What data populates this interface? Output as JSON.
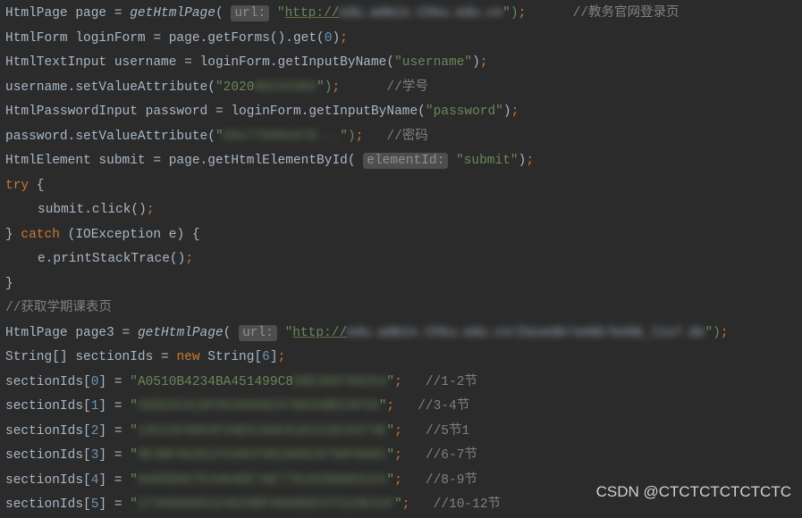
{
  "lines": {
    "l1": {
      "p1": "HtmlPage page = ",
      "method": "getHtmlPage",
      "hint": "url:",
      "q": "\"",
      "url": "http://",
      "blur": "edu.admin.thku.edu.cn",
      "end": "\")",
      "comment": "//教务官网登录页"
    },
    "l2": {
      "text": "HtmlForm loginForm = page.getForms().get(",
      "num": "0",
      "end": ")"
    },
    "l3": {
      "text": "HtmlTextInput username = loginForm.getInputByName(",
      "str": "\"username\"",
      "end": ")"
    },
    "l4": {
      "p1": "username.setValueAttribute(",
      "q": "\"",
      "vis": "2020",
      "blur": "88244384",
      "end": "\")",
      "comment": "//学号"
    },
    "l5": {
      "text": "HtmlPasswordInput password = loginForm.getInputByName(",
      "str": "\"password\"",
      "end": ")"
    },
    "l6": {
      "p1": "password.setValueAttribute(",
      "q": "\"",
      "blur": "K9x779684470...",
      "end": "\")",
      "comment": "//密码"
    },
    "l7": {
      "p1": "HtmlElement submit = page.getHtmlElementById( ",
      "hint": "elementId:",
      "str": "\"submit\"",
      "end": ")"
    },
    "l8": {
      "kw": "try",
      "brace": " {"
    },
    "l9": {
      "text": "submit.click()"
    },
    "l10": {
      "close": "} ",
      "kw": "catch",
      "params": " (IOException e) {"
    },
    "l11": {
      "text": "e.printStackTrace()"
    },
    "l12": {
      "close": "}"
    },
    "l13": {
      "comment": "//获取学期课表页"
    },
    "l14": {
      "p1": "HtmlPage page3 = ",
      "method": "getHtmlPage",
      "hint": "url:",
      "q": "\"",
      "url": "http://",
      "blur": "edu.admin.thku.edu.cn/ZaxedA/sebb/kebb_lis7.de",
      "end": "\")"
    },
    "l15": {
      "p1": "String[] sectionIds = ",
      "new": "new",
      "p2": " String[",
      "num": "6",
      "end": "]"
    },
    "s0": {
      "p1": "sectionIds[",
      "idx": "0",
      "p2": "] = ",
      "q": "\"",
      "vis": "A0510B4234BA451499C8",
      "blur": "00E3A0796254",
      "end": "\"",
      "comment": "//1-2节"
    },
    "s1": {
      "p1": "sectionIds[",
      "idx": "1",
      "p2": "] = ",
      "q": "\"",
      "blur": "CEEE5CA18F95469682478834BECAF59",
      "end": "\"",
      "comment": "//3-4节"
    },
    "s2": {
      "p1": "sectionIds[",
      "idx": "2",
      "p2": "] = ",
      "q": "\"",
      "blur": "13CC5FA094F34E519AFA1A151EC9474E",
      "end": "\"",
      "comment": "//5节1"
    },
    "s3": {
      "p1": "sectionIds[",
      "idx": "3",
      "p2": "] = ",
      "q": "\"",
      "blur": "9E4BF60361F648CF982A89C8790F8A81",
      "end": "\"",
      "comment": "//6-7节"
    },
    "s4": {
      "p1": "sectionIds[",
      "idx": "4",
      "p2": "] = ",
      "q": "\"",
      "blur": "0485D067E3484EE7AE77810200A83153",
      "end": "\"",
      "comment": "//8-9节"
    },
    "s5": {
      "p1": "sectionIds[",
      "idx": "5",
      "p2": "] = ",
      "q": "\"",
      "blur": "273980086324820BF9008DECFF529E31F",
      "end": "\"",
      "comment": "//10-12节"
    }
  },
  "watermark": "CSDN @CTCTCTCTCTCTC"
}
